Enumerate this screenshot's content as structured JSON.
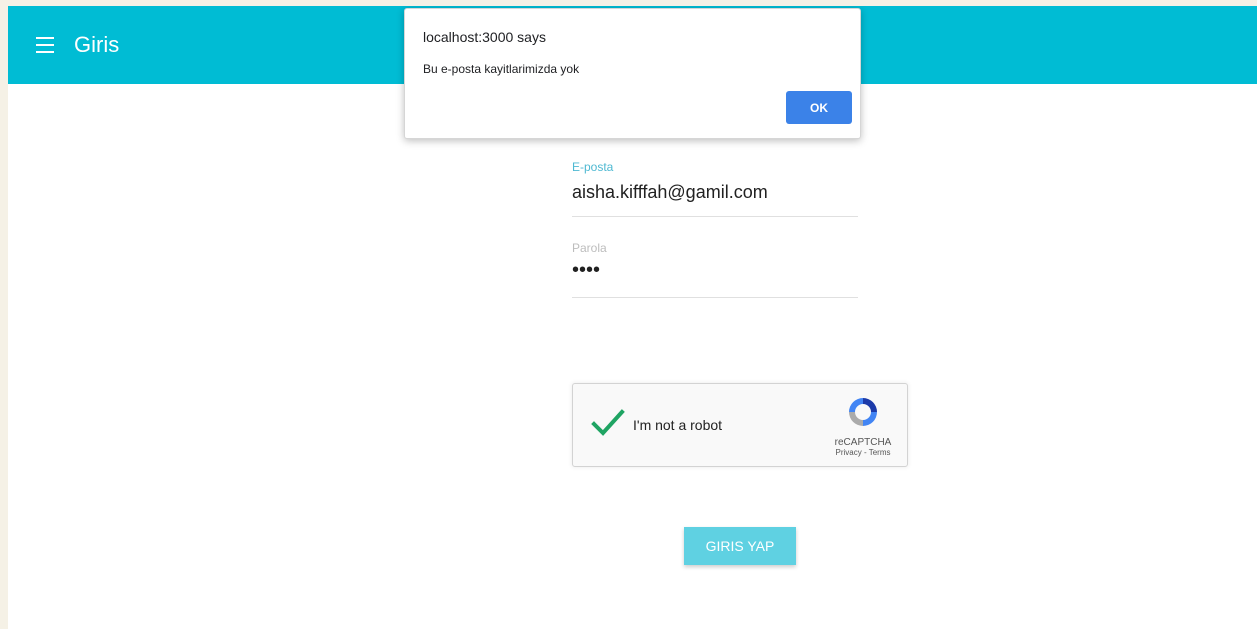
{
  "appbar": {
    "title": "Giris",
    "menu_icon": "menu-icon",
    "color": "#00bcd4"
  },
  "form": {
    "email_label": "E-posta",
    "email_value": "aisha.kifffah@gamil.com",
    "password_label": "Parola",
    "password_value": "••••"
  },
  "captcha": {
    "label": "I'm not a robot",
    "brand": "reCAPTCHA",
    "links": "Privacy - Terms",
    "checked": true,
    "check_color": "#1fa463"
  },
  "login_button": {
    "label": "GIRIS YAP",
    "color": "#5fd1e2"
  },
  "dialog": {
    "title": "localhost:3000 says",
    "message": "Bu e-posta kayitlarimizda yok",
    "ok_label": "OK",
    "ok_color": "#3b82e8"
  }
}
